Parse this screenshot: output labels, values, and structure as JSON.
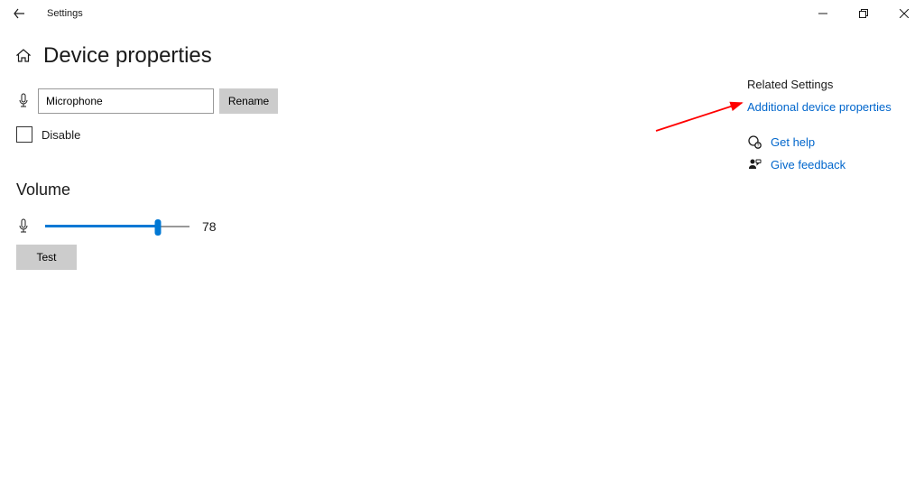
{
  "titlebar": {
    "title": "Settings"
  },
  "page": {
    "title": "Device properties"
  },
  "device": {
    "name": "Microphone",
    "rename_label": "Rename"
  },
  "disable": {
    "label": "Disable",
    "checked": false
  },
  "volume": {
    "header": "Volume",
    "value": "78",
    "percent": 78,
    "test_label": "Test"
  },
  "sidebar": {
    "header": "Related Settings",
    "additional_link": "Additional device properties",
    "help_link": "Get help",
    "feedback_link": "Give feedback"
  }
}
